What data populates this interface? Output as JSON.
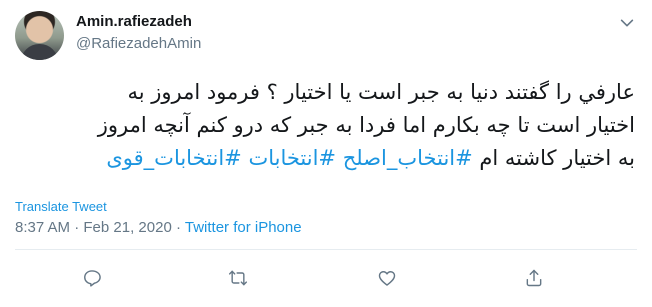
{
  "author": {
    "display_name": "Amin.rafiezadeh",
    "handle": "@RafiezadehAmin"
  },
  "tweet": {
    "lines": [
      "عارفي را گفتند دنيا به جبر است يا اختيار ؟ فرمود امروز به",
      "اختيار است تا چه بكارم اما فردا به جبر  كه درو كنم آنچه امروز"
    ],
    "line3_prefix": "به اختيار كاشته ام ",
    "hashtags": [
      "#انتخاب_اصلح",
      "#انتخابات",
      "#انتخابات_قوی"
    ]
  },
  "translate_label": "Translate Tweet",
  "meta": {
    "time": "8:37 AM",
    "separator": " · ",
    "date": "Feb 21, 2020",
    "source": "Twitter for iPhone"
  },
  "icons": {
    "more": "chevron-down-icon",
    "reply": "reply-icon",
    "retweet": "retweet-icon",
    "like": "heart-icon",
    "share": "share-icon"
  },
  "colors": {
    "link": "#1b95e0",
    "secondary_text": "#657786",
    "primary_text": "#14171a"
  }
}
